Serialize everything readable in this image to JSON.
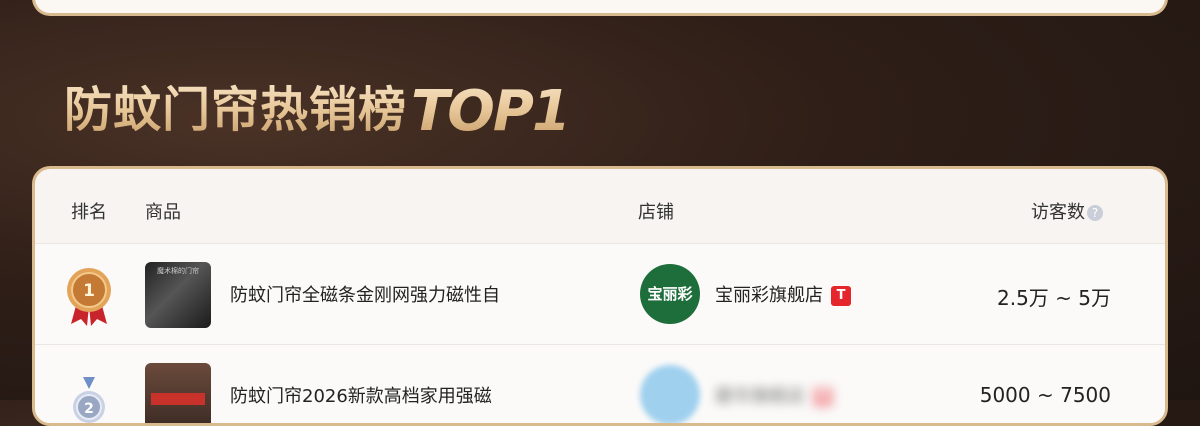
{
  "title": {
    "cn": "防蚊门帘热销榜",
    "en": "TOP1"
  },
  "table": {
    "headers": {
      "rank": "排名",
      "product": "商品",
      "shop": "店铺",
      "visitors": "访客数"
    },
    "rows": [
      {
        "rank": "1",
        "product_image_text": "魔术棉的门帘",
        "product_name": "防蚊门帘全磁条金刚网强力磁性自",
        "shop_logo_text": "宝丽彩",
        "shop_name": "宝丽彩旗舰店",
        "shop_badge": "T",
        "visitors": "2.5万 ~ 5万"
      },
      {
        "rank": "2",
        "product_name": "防蚊门帘2026新款高档家用强磁",
        "shop_name": "碧华旗舰店",
        "shop_badge": "T",
        "visitors": "5000 ~ 7500"
      }
    ]
  },
  "colors": {
    "accent_gold": "#d9b98e",
    "tmall_red": "#e5272d",
    "medal_gold": "#c47a34",
    "medal_silver": "#9aa7c2"
  },
  "icons": {
    "help": "help-circle-icon",
    "medal_1": "gold-medal-icon",
    "medal_2": "silver-medal-icon"
  }
}
